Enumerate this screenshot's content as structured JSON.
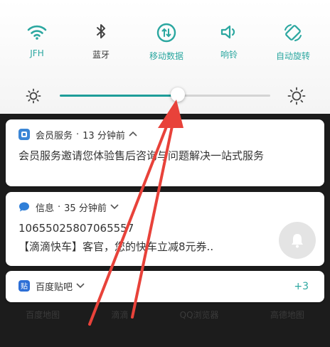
{
  "quick_settings": {
    "toggles": [
      {
        "label": "JFH",
        "icon": "wifi-icon",
        "active": true
      },
      {
        "label": "蓝牙",
        "icon": "bluetooth-icon",
        "active": false
      },
      {
        "label": "移动数据",
        "icon": "mobile-data-icon",
        "active": true
      },
      {
        "label": "响铃",
        "icon": "ring-volume-icon",
        "active": true
      },
      {
        "label": "自动旋转",
        "icon": "auto-rotate-icon",
        "active": true
      }
    ],
    "brightness_level": 0.56
  },
  "notifications": [
    {
      "app": "会员服务",
      "time": "13 分钟前",
      "icon": "member-service-icon",
      "body": "会员服务邀请您体验售后咨询与问题解决一站式服务"
    },
    {
      "app": "信息",
      "time": "35 分钟前",
      "icon": "message-icon",
      "title": "10655025807065557",
      "body": "【滴滴快车】客官，您的快车立减8元券.."
    },
    {
      "app": "百度贴吧",
      "icon": "baidu-tieba-icon",
      "count": "+3"
    }
  ],
  "dock_labels": [
    "百度地图",
    "滴滴",
    "QQ浏览器",
    "高德地图"
  ],
  "colors": {
    "accent": "#2ba7a0",
    "slider": "#1e9d99",
    "arrow": "#e8423a"
  }
}
